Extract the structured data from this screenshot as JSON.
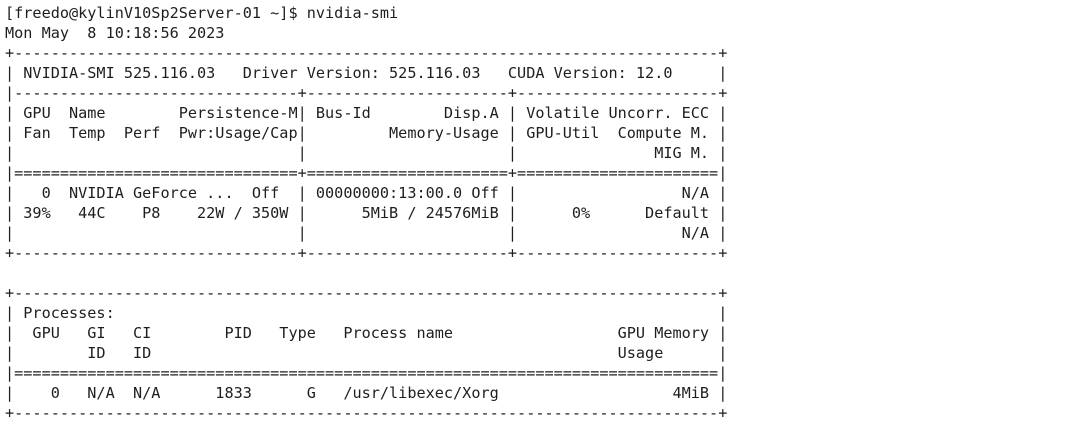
{
  "terminal": {
    "prompt": "[freedo@kylinV10Sp2Server-01 ~]$ ",
    "command": "nvidia-smi",
    "date": "Mon May  8 10:18:56 2023"
  },
  "smi_header": {
    "border_top": "+-----------------------------------------------------------------------------+",
    "version_line": "| NVIDIA-SMI 525.116.03   Driver Version: 525.116.03   CUDA Version: 12.0     |",
    "separator": "|-------------------------------+----------------------+----------------------+",
    "col_header_1": "| GPU  Name        Persistence-M| Bus-Id        Disp.A | Volatile Uncorr. ECC |",
    "col_header_2": "| Fan  Temp  Perf  Pwr:Usage/Cap|         Memory-Usage | GPU-Util  Compute M. |",
    "col_header_3": "|                               |                      |               MIG M. |",
    "double_separator": "|===============================+======================+======================|"
  },
  "gpu": {
    "row_1": "|   0  NVIDIA GeForce ...  Off  | 00000000:13:00.0 Off |                  N/A |",
    "row_2": "| 39%   44C    P8    22W / 350W |      5MiB / 24576MiB |      0%      Default |",
    "row_3": "|                               |                      |                  N/A |",
    "border_bottom": "+-------------------------------+----------------------+----------------------+"
  },
  "processes": {
    "blank": "",
    "border_top": "+-----------------------------------------------------------------------------+",
    "title": "| Processes:                                                                  |",
    "header_1": "|  GPU   GI   CI        PID   Type   Process name                  GPU Memory |",
    "header_2": "|        ID   ID                                                   Usage      |",
    "double_separator": "|=============================================================================|",
    "row_1": "|    0   N/A  N/A      1833      G   /usr/libexec/Xorg                   4MiB |",
    "border_bottom": "+-----------------------------------------------------------------------------+"
  }
}
